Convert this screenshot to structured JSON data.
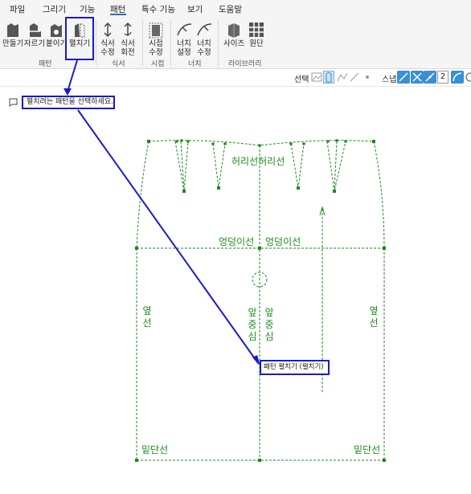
{
  "menu": {
    "items": [
      "파일",
      "그리기",
      "기능",
      "패턴",
      "특수 기능",
      "보기",
      "도움말"
    ],
    "active": "패턴"
  },
  "ribbon": {
    "pattern_group": {
      "buttons": [
        "만들기",
        "자르기",
        "붙이기",
        "펼치기"
      ],
      "label": "패턴"
    },
    "seam_group": {
      "buttons": [
        "식서\n수정",
        "식서\n회전"
      ],
      "label": "식서"
    },
    "grain_group": {
      "buttons": [
        "시접\n수정"
      ],
      "label": "시접"
    },
    "notch_group": {
      "buttons": [
        "너치\n설정",
        "너치\n수정"
      ],
      "label": "너치"
    },
    "library_group": {
      "buttons": [
        "사이즈",
        "원단"
      ],
      "label": "라이브러리"
    }
  },
  "toolbar": {
    "select_label": "선택",
    "snap_label": "스냅",
    "snap_value": "2"
  },
  "hint": {
    "text": "펼치려는 패턴을 선택하세요."
  },
  "pattern": {
    "waist_label": "허리선허리선",
    "hip_left": "엉덩이선",
    "hip_right": "엉덩이선",
    "side_left": "옆선",
    "side_right": "옆선",
    "front_center_left": "앞중심",
    "front_center_right": "앞중심",
    "hem_left": "밑단선",
    "hem_right": "밑단선"
  },
  "tooltip": {
    "text": "패턴 펼치기 (펼치기)"
  },
  "colors": {
    "pattern_green": "#1e8a1e",
    "annotation_blue": "#1a1aca",
    "toolbar_blue": "#3a8fd6"
  }
}
